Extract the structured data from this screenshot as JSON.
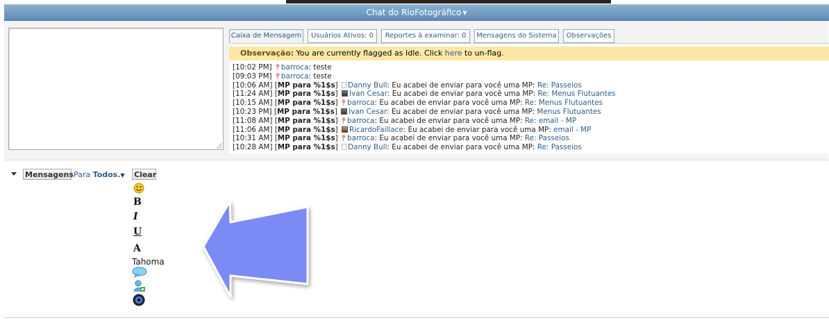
{
  "window": {
    "title": "Chat do RioFotográfico"
  },
  "tabs": [
    {
      "label": "Caixa de Mensagem"
    },
    {
      "label": "Usuários Ativos: 0"
    },
    {
      "label": "Reportes à examinar: 0"
    },
    {
      "label": "Mensagens do Sistema"
    },
    {
      "label": "Observações"
    }
  ],
  "notice": {
    "label": "Observação:",
    "text": " You are currently flagged as Idle. Click ",
    "link": "here",
    "tail": " to un-flag."
  },
  "messages": [
    {
      "time": "[10:02 PM]",
      "icon": "pin",
      "user": "barroca",
      "text": ": teste"
    },
    {
      "time": "[09:03 PM]",
      "icon": "pin",
      "user": "barroca",
      "text": ": teste"
    },
    {
      "time": "[10:06 AM]",
      "prefix": "MP para %1$s",
      "icon": "blank",
      "user": "Danny Bull",
      "text": ": Eu acabei de enviar para você uma MP: ",
      "link": "Re: Passeios"
    },
    {
      "time": "[11:24 AM]",
      "prefix": "MP para %1$s",
      "icon": "photo",
      "user": "Ivan Cesar",
      "text": ": Eu acabei de enviar para você uma MP: ",
      "link": "Re: Menus Flutuantes"
    },
    {
      "time": "[10:15 AM]",
      "prefix": "MP para %1$s",
      "icon": "pin",
      "user": "barroca",
      "text": ": Eu acabei de enviar para você uma MP: ",
      "link": "Re: Menus Flutuantes"
    },
    {
      "time": "[10:23 PM]",
      "prefix": "MP para %1$s",
      "icon": "photo",
      "user": "Ivan Cesar",
      "text": ": Eu acabei de enviar para você uma MP: ",
      "link": "Menus Flutuantes"
    },
    {
      "time": "[11:08 AM]",
      "prefix": "MP para %1$s",
      "icon": "pin",
      "user": "barroca",
      "text": ": Eu acabei de enviar para você uma MP: ",
      "link": "Re: email - MP"
    },
    {
      "time": "[11:06 AM]",
      "prefix": "MP para %1$s",
      "icon": "person",
      "user": "RicardoFaillace",
      "text": ": Eu acabei de enviar para você uma MP: ",
      "link": "email - MP"
    },
    {
      "time": "[10:31 AM]",
      "prefix": "MP para %1$s",
      "icon": "pin",
      "user": "barroca",
      "text": ": Eu acabei de enviar para você uma MP: ",
      "link": "Re: Passeios"
    },
    {
      "time": "[10:28 AM]",
      "prefix": "MP para %1$s",
      "icon": "blank",
      "user": "Danny Bull",
      "text": ": Eu acabei de enviar para você uma MP: ",
      "link": "Re: Passeios"
    }
  ],
  "composer": {
    "mode_label": "Mensagens",
    "para_label": "Para",
    "target": "Todos.",
    "clear_label": "Clear",
    "bold": "B",
    "italic": "I",
    "underline": "U",
    "color": "A",
    "font": "Tahoma"
  },
  "icons": [
    "smiley-icon",
    "speech-bubble-icon",
    "add-user-icon",
    "sound-icon",
    "collapse-arrow-icon",
    "pointer-arrow-icon"
  ],
  "colors": {
    "title_bar": "#6d97bf",
    "link": "#2d5b8a",
    "notice_bg": "#fce8a4",
    "arrow": "#7b8af5"
  }
}
